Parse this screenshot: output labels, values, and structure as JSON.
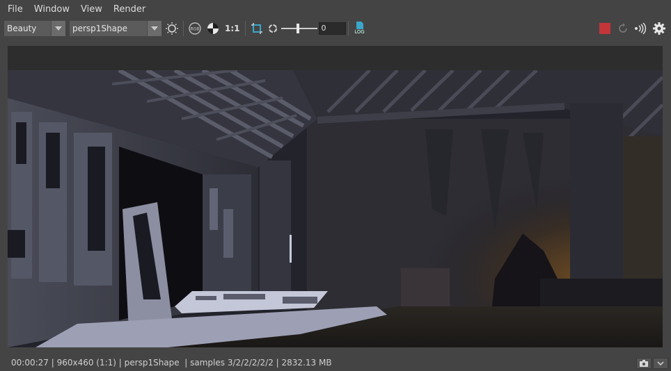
{
  "menu": [
    "File",
    "Window",
    "View",
    "Render"
  ],
  "toolbar": {
    "aov_select": "Beauty",
    "camera_select": "persp1Shape",
    "ratio_label": "1:1",
    "exposure_value": "0",
    "log_label": "LOG"
  },
  "status": {
    "text": "00:00:27 | 960x460 (1:1) | persp1Shape  | samples 3/2/2/2/2/2 | 2832.13 MB"
  },
  "colors": {
    "stop_button": "#c4353a",
    "accent_blue": "#3aa6c9"
  },
  "icons": [
    "aov-dropdown-arrow",
    "camera-dropdown-arrow",
    "exposure-icon",
    "rgb-icon",
    "alpha-icon",
    "crop-region-icon",
    "refresh-icon",
    "log-icon",
    "stop-icon",
    "rerender-icon",
    "ipr-icon",
    "settings-icon",
    "snapshot-icon",
    "chevron-down-icon"
  ]
}
